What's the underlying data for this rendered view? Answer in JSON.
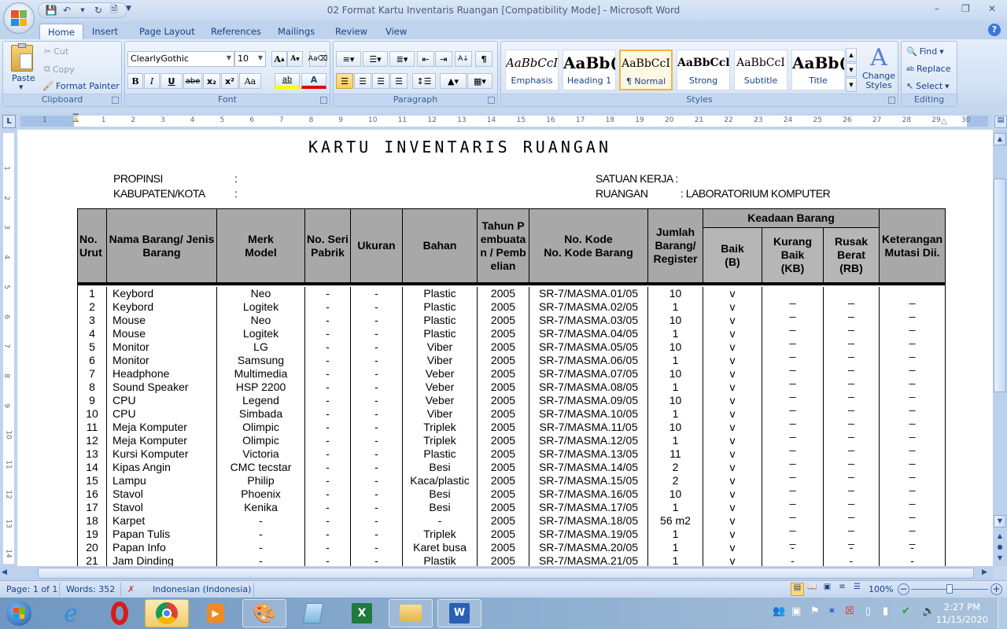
{
  "window": {
    "title": "02 Format Kartu Inventaris Ruangan [Compatibility Mode] - Microsoft Word",
    "controls": [
      "minimize",
      "restore",
      "close"
    ]
  },
  "quick_access": [
    "save-icon",
    "undo-icon",
    "redo-icon",
    "print-preview-icon",
    "customize-dropdown-icon"
  ],
  "tabs": [
    {
      "label": "Home",
      "active": true
    },
    {
      "label": "Insert"
    },
    {
      "label": "Page Layout"
    },
    {
      "label": "References"
    },
    {
      "label": "Mailings"
    },
    {
      "label": "Review"
    },
    {
      "label": "View"
    }
  ],
  "ribbon": {
    "clipboard": {
      "label": "Clipboard",
      "paste": "Paste",
      "cut": "Cut",
      "copy": "Copy",
      "format_painter": "Format Painter"
    },
    "font": {
      "label": "Font",
      "font_name": "ClearlyGothic",
      "font_size": "10",
      "bold": "B",
      "italic": "I",
      "underline": "U",
      "strike": "abe",
      "subscript": "x₂",
      "superscript": "x²",
      "change_case": "Aa",
      "highlight": "ab",
      "font_color": "A",
      "grow": "A",
      "shrink": "A"
    },
    "paragraph": {
      "label": "Paragraph"
    },
    "styles": {
      "label": "Styles",
      "items": [
        {
          "preview": "AaBbCcI",
          "name": "Emphasis"
        },
        {
          "preview": "AaBb(",
          "name": "Heading 1"
        },
        {
          "preview": "AaBbCcI",
          "name": "¶ Normal",
          "selected": true
        },
        {
          "preview": "AaBbCcl",
          "name": "Strong"
        },
        {
          "preview": "AaBbCcI",
          "name": "Subtitle"
        },
        {
          "preview": "AaBb(",
          "name": "Title"
        }
      ],
      "change_styles": "Change Styles"
    },
    "editing": {
      "label": "Editing",
      "find": "Find",
      "replace": "Replace",
      "select": "Select"
    }
  },
  "ruler": {
    "h_numbers": [
      "1",
      "1",
      "2",
      "3",
      "4",
      "5",
      "6",
      "7",
      "8",
      "9",
      "10",
      "11",
      "12",
      "13",
      "14",
      "15",
      "16",
      "17",
      "18",
      "19",
      "20",
      "21",
      "22",
      "23",
      "24",
      "25",
      "26",
      "27",
      "28",
      "29",
      "30"
    ],
    "v_numbers": [
      "1",
      "2",
      "3",
      "4",
      "5",
      "6",
      "7",
      "8",
      "9",
      "10",
      "11",
      "12",
      "13",
      "14"
    ]
  },
  "document": {
    "title": "KARTU  INVENTARIS  RUANGAN",
    "meta_left": [
      {
        "label": "PROPINSI",
        "value": ":"
      },
      {
        "label": "KABUPATEN/KOTA",
        "value": ":"
      }
    ],
    "meta_right": [
      {
        "label": "SATUAN KERJA :",
        "value": ""
      },
      {
        "label": "RUANGAN",
        "value": ": LABORATORIUM KOMPUTER"
      }
    ],
    "table": {
      "headers": {
        "no": "No. Urut",
        "nama": "Nama Barang/ Jenis Barang",
        "merk": "Merk Model",
        "seri": "No. Seri Pabrik",
        "ukuran": "Ukuran",
        "bahan": "Bahan",
        "tahun": "Tahun Pembuatan / Pembelian",
        "kode1": "No. Kode",
        "kode2": "No. Kode Barang",
        "jumlah": "Jumlah Barang/ Register",
        "keadaan": "Keadaan Barang",
        "baik": "Baik (B)",
        "kurang": "Kurang Baik (KB)",
        "rusak": "Rusak Berat (RB)",
        "ket": "Keterangan Mutasi Dii."
      },
      "rows": [
        {
          "no": "1",
          "nama": "Keybord",
          "merk": "Neo",
          "seri": "-",
          "ukuran": "-",
          "bahan": "Plastic",
          "tahun": "2005",
          "kode": "SR-7/MASMA.01/05",
          "jumlah": "10",
          "baik": "v",
          "kb": "_",
          "rb": "_",
          "ket": "_"
        },
        {
          "no": "2",
          "nama": "Keybord",
          "merk": "Logitek",
          "seri": "-",
          "ukuran": "-",
          "bahan": "Plastic",
          "tahun": "2005",
          "kode": "SR-7/MASMA.02/05",
          "jumlah": "1",
          "baik": "v",
          "kb": "_",
          "rb": "_",
          "ket": "_"
        },
        {
          "no": "3",
          "nama": "Mouse",
          "merk": "Neo",
          "seri": "-",
          "ukuran": "-",
          "bahan": "Plastic",
          "tahun": "2005",
          "kode": "SR-7/MASMA.03/05",
          "jumlah": "10",
          "baik": "v",
          "kb": "_",
          "rb": "_",
          "ket": "_"
        },
        {
          "no": "4",
          "nama": "Mouse",
          "merk": "Logitek",
          "seri": "-",
          "ukuran": "-",
          "bahan": "Plastic",
          "tahun": "2005",
          "kode": "SR-7/MASMA.04/05",
          "jumlah": "1",
          "baik": "v",
          "kb": "_",
          "rb": "_",
          "ket": "_"
        },
        {
          "no": "5",
          "nama": "Monitor",
          "merk": "LG",
          "seri": "-",
          "ukuran": "-",
          "bahan": "Viber",
          "tahun": "2005",
          "kode": "SR-7/MASMA.05/05",
          "jumlah": "10",
          "baik": "v",
          "kb": "_",
          "rb": "_",
          "ket": "_"
        },
        {
          "no": "6",
          "nama": "Monitor",
          "merk": "Samsung",
          "seri": "-",
          "ukuran": "-",
          "bahan": "Viber",
          "tahun": "2005",
          "kode": "SR-7/MASMA.06/05",
          "jumlah": "1",
          "baik": "v",
          "kb": "_",
          "rb": "_",
          "ket": "_"
        },
        {
          "no": "7",
          "nama": "Headphone",
          "merk": "Multimedia",
          "seri": "-",
          "ukuran": "-",
          "bahan": "Veber",
          "tahun": "2005",
          "kode": "SR-7/MASMA.07/05",
          "jumlah": "10",
          "baik": "v",
          "kb": "_",
          "rb": "_",
          "ket": "_"
        },
        {
          "no": "8",
          "nama": "Sound Speaker",
          "merk": "HSP 2200",
          "seri": "-",
          "ukuran": "-",
          "bahan": "Veber",
          "tahun": "2005",
          "kode": "SR-7/MASMA.08/05",
          "jumlah": "1",
          "baik": "v",
          "kb": "_",
          "rb": "_",
          "ket": "_"
        },
        {
          "no": "9",
          "nama": "CPU",
          "merk": "Legend",
          "seri": "-",
          "ukuran": "-",
          "bahan": "Veber",
          "tahun": "2005",
          "kode": "SR-7/MASMA.09/05",
          "jumlah": "10",
          "baik": "v",
          "kb": "_",
          "rb": "_",
          "ket": "_"
        },
        {
          "no": "10",
          "nama": "CPU",
          "merk": "Simbada",
          "seri": "-",
          "ukuran": "-",
          "bahan": "Viber",
          "tahun": "2005",
          "kode": "SR-7/MASMA.10/05",
          "jumlah": "1",
          "baik": "v",
          "kb": "_",
          "rb": "_",
          "ket": "_"
        },
        {
          "no": "11",
          "nama": "Meja Komputer",
          "merk": "Olimpic",
          "seri": "-",
          "ukuran": "-",
          "bahan": "Triplek",
          "tahun": "2005",
          "kode": "SR-7/MASMA.11/05",
          "jumlah": "10",
          "baik": "v",
          "kb": "_",
          "rb": "_",
          "ket": "_"
        },
        {
          "no": "12",
          "nama": "Meja Komputer",
          "merk": "Olimpic",
          "seri": "-",
          "ukuran": "-",
          "bahan": "Triplek",
          "tahun": "2005",
          "kode": "SR-7/MASMA.12/05",
          "jumlah": "1",
          "baik": "v",
          "kb": "_",
          "rb": "_",
          "ket": "_"
        },
        {
          "no": "13",
          "nama": "Kursi Komputer",
          "merk": "Victoria",
          "seri": "-",
          "ukuran": "-",
          "bahan": "Plastic",
          "tahun": "2005",
          "kode": "SR-7/MASMA.13/05",
          "jumlah": "11",
          "baik": "v",
          "kb": "_",
          "rb": "_",
          "ket": "_"
        },
        {
          "no": "14",
          "nama": "Kipas Angin",
          "merk": "CMC tecstar",
          "seri": "-",
          "ukuran": "-",
          "bahan": "Besi",
          "tahun": "2005",
          "kode": "SR-7/MASMA.14/05",
          "jumlah": "2",
          "baik": "v",
          "kb": "_",
          "rb": "_",
          "ket": "_"
        },
        {
          "no": "15",
          "nama": "Lampu",
          "merk": "Philip",
          "seri": "-",
          "ukuran": "-",
          "bahan": "Kaca/plastic",
          "tahun": "2005",
          "kode": "SR-7/MASMA.15/05",
          "jumlah": "2",
          "baik": "v",
          "kb": "_",
          "rb": "_",
          "ket": "_"
        },
        {
          "no": "16",
          "nama": "Stavol",
          "merk": "Phoenix",
          "seri": "-",
          "ukuran": "-",
          "bahan": "Besi",
          "tahun": "2005",
          "kode": "SR-7/MASMA.16/05",
          "jumlah": "10",
          "baik": "v",
          "kb": "_",
          "rb": "_",
          "ket": "_"
        },
        {
          "no": "17",
          "nama": "Stavol",
          "merk": "Kenika",
          "seri": "-",
          "ukuran": "-",
          "bahan": "Besi",
          "tahun": "2005",
          "kode": "SR-7/MASMA.17/05",
          "jumlah": "1",
          "baik": "v",
          "kb": "_",
          "rb": "_",
          "ket": "_"
        },
        {
          "no": "18",
          "nama": "Karpet",
          "merk": "-",
          "seri": "-",
          "ukuran": "-",
          "bahan": "-",
          "tahun": "2005",
          "kode": "SR-7/MASMA.18/05",
          "jumlah": "56 m2",
          "baik": "v",
          "kb": "_",
          "rb": "_",
          "ket": "_"
        },
        {
          "no": "19",
          "nama": "Papan Tulis",
          "merk": "-",
          "seri": "-",
          "ukuran": "-",
          "bahan": "Triplek",
          "tahun": "2005",
          "kode": "SR-7/MASMA.19/05",
          "jumlah": "1",
          "baik": "v",
          "kb": "_",
          "rb": "_",
          "ket": "_"
        },
        {
          "no": "20",
          "nama": "Papan Info",
          "merk": "-",
          "seri": "-",
          "ukuran": "-",
          "bahan": "Karet busa",
          "tahun": "2005",
          "kode": "SR-7/MASMA.20/05",
          "jumlah": "1",
          "baik": "v",
          "kb": "-",
          "rb": "-",
          "ket": "-"
        },
        {
          "no": "21",
          "nama": "Jam Dinding",
          "merk": "-",
          "seri": "-",
          "ukuran": "-",
          "bahan": "Plastik",
          "tahun": "2005",
          "kode": "SR-7/MASMA.21/05",
          "jumlah": "1",
          "baik": "v",
          "kb": "-",
          "rb": "-",
          "ket": "-"
        }
      ]
    }
  },
  "statusbar": {
    "page": "Page: 1 of 1",
    "words": "Words: 352",
    "language": "Indonesian (Indonesia)",
    "zoom": "100%",
    "zoom_level_percent": 100
  },
  "taskbar": {
    "apps": [
      "start",
      "internet-explorer",
      "opera",
      "chrome",
      "media-player",
      "paint",
      "notepad",
      "excel",
      "explorer",
      "word"
    ],
    "time": "2:27 PM",
    "date": "11/15/2020"
  }
}
